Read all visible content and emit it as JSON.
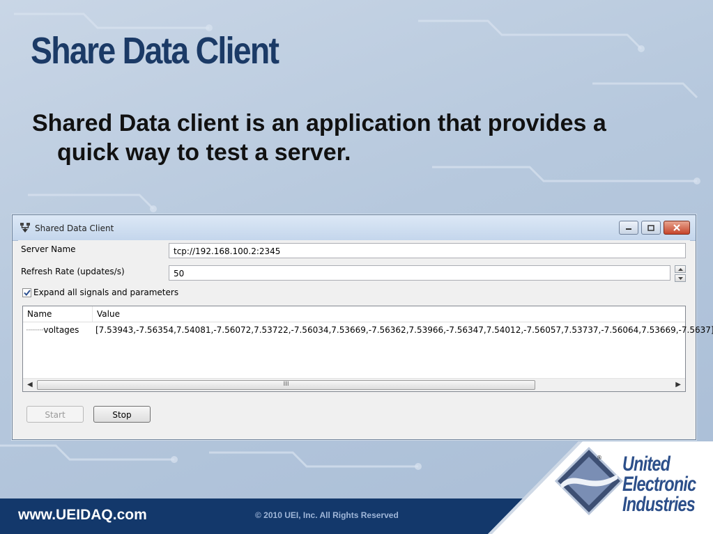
{
  "slide": {
    "title": "Share Data Client",
    "body": "Shared Data client is an application that provides a quick way to test a server."
  },
  "window": {
    "title": "Shared Data Client",
    "fields": {
      "server_name_label": "Server Name",
      "server_name_value": "tcp://192.168.100.2:2345",
      "refresh_rate_label": "Refresh Rate (updates/s)",
      "refresh_rate_value": "50",
      "expand_label": "Expand all signals and parameters",
      "expand_checked": true
    },
    "tree": {
      "columns": [
        "Name",
        "Value"
      ],
      "rows": [
        {
          "name": "voltages",
          "value": "[7.53943,-7.56354,7.54081,-7.56072,7.53722,-7.56034,7.53669,-7.56362,7.53966,-7.56347,7.54012,-7.56057,7.53737,-7.56064,7.53669,-7.5637]"
        }
      ],
      "scroll_thumb_glyph": "III"
    },
    "buttons": {
      "start": "Start",
      "stop": "Stop"
    }
  },
  "footer": {
    "url": "www.UEIDAQ.com",
    "copyright": "© 2010 UEI, Inc. All Rights Reserved"
  },
  "logo": {
    "lines": [
      "United",
      "Electronic",
      "Industries"
    ],
    "registered": "®"
  },
  "colors": {
    "title": "#1b3a66",
    "footer_bar": "#13386b",
    "logo_text": "#2c4f8a"
  }
}
